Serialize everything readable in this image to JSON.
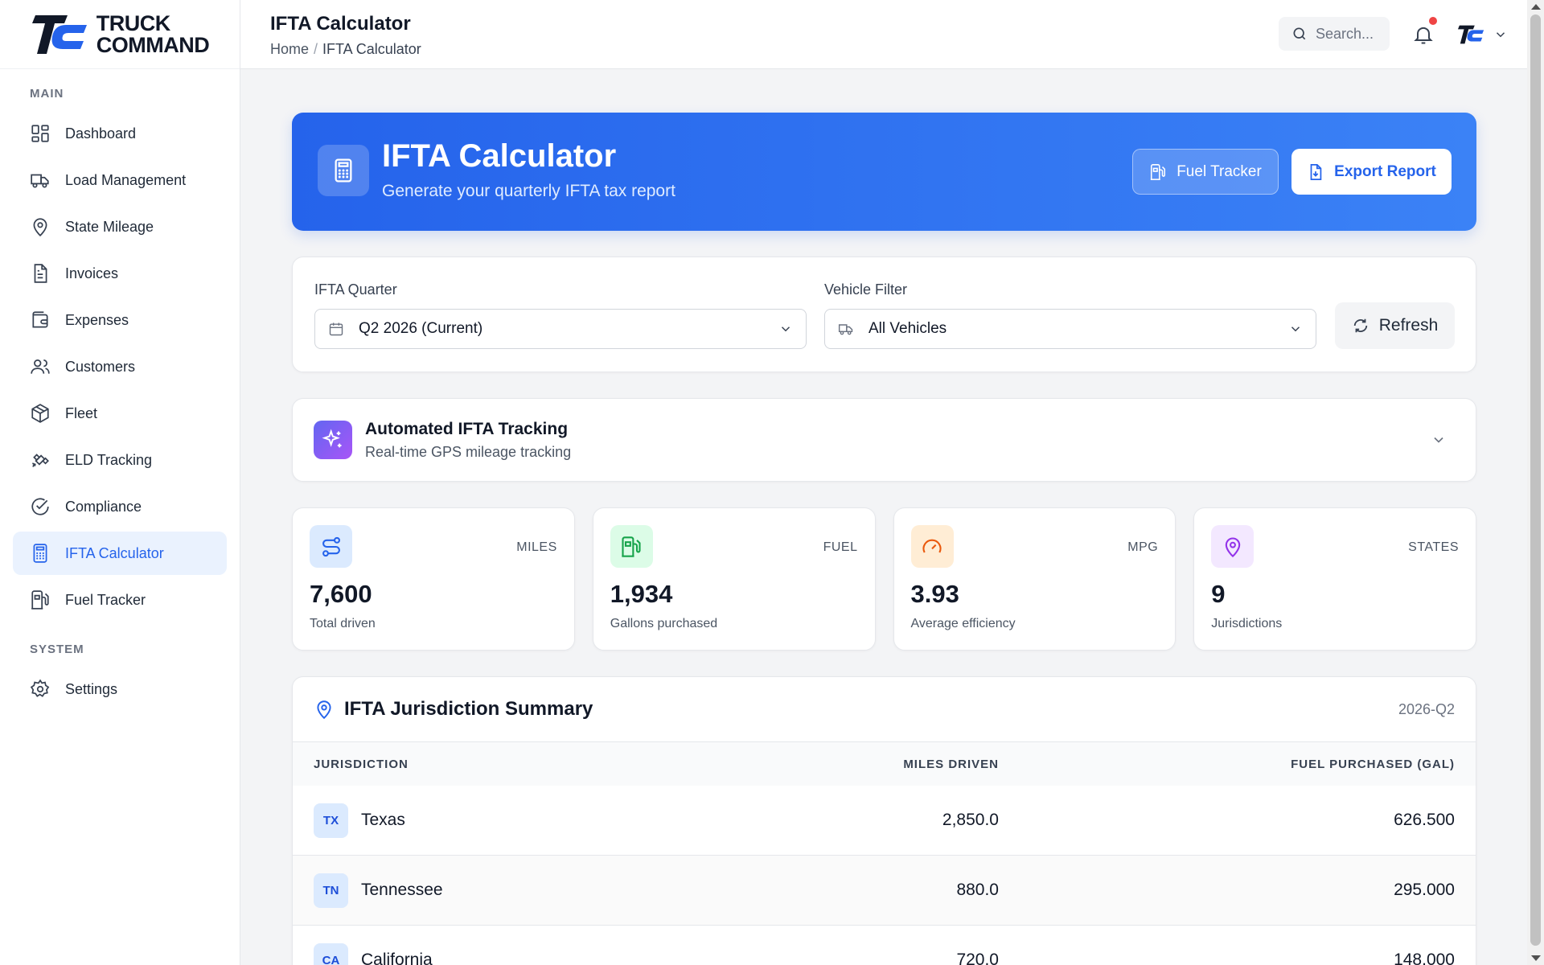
{
  "brand": {
    "line1": "TRUCK",
    "line2": "COMMAND",
    "accent": "#2563eb"
  },
  "sidebar": {
    "main_label": "MAIN",
    "items": [
      {
        "label": "Dashboard",
        "icon": "grid-icon"
      },
      {
        "label": "Load Management",
        "icon": "truck-icon"
      },
      {
        "label": "State Mileage",
        "icon": "map-pin-icon"
      },
      {
        "label": "Invoices",
        "icon": "file-icon"
      },
      {
        "label": "Expenses",
        "icon": "wallet-icon"
      },
      {
        "label": "Customers",
        "icon": "users-icon"
      },
      {
        "label": "Fleet",
        "icon": "package-icon"
      },
      {
        "label": "ELD Tracking",
        "icon": "satellite-icon"
      },
      {
        "label": "Compliance",
        "icon": "check-circle-icon"
      },
      {
        "label": "IFTA Calculator",
        "icon": "calculator-icon",
        "active": true
      },
      {
        "label": "Fuel Tracker",
        "icon": "fuel-icon"
      }
    ],
    "system_label": "SYSTEM",
    "system_items": [
      {
        "label": "Settings",
        "icon": "gear-icon"
      }
    ]
  },
  "header": {
    "title": "IFTA Calculator",
    "breadcrumb": {
      "home": "Home",
      "separator": "/",
      "current": "IFTA Calculator"
    },
    "search_placeholder": "Search..."
  },
  "hero": {
    "title": "IFTA Calculator",
    "subtitle": "Generate your quarterly IFTA tax report",
    "fuel_tracker_label": "Fuel Tracker",
    "export_label": "Export Report"
  },
  "filters": {
    "quarter_label": "IFTA Quarter",
    "quarter_value": "Q2 2026 (Current)",
    "vehicle_label": "Vehicle Filter",
    "vehicle_value": "All Vehicles",
    "refresh_label": "Refresh"
  },
  "automation": {
    "title": "Automated IFTA Tracking",
    "subtitle": "Real-time GPS mileage tracking"
  },
  "stats": [
    {
      "label": "MILES",
      "value": "7,600",
      "caption": "Total driven",
      "bg": "#dbeafe",
      "fg": "#2563eb"
    },
    {
      "label": "FUEL",
      "value": "1,934",
      "caption": "Gallons purchased",
      "bg": "#dcfce7",
      "fg": "#16a34a"
    },
    {
      "label": "MPG",
      "value": "3.93",
      "caption": "Average efficiency",
      "bg": "#ffedd5",
      "fg": "#ea580c"
    },
    {
      "label": "STATES",
      "value": "9",
      "caption": "Jurisdictions",
      "bg": "#f3e8ff",
      "fg": "#9333ea"
    }
  ],
  "summary": {
    "title": "IFTA Jurisdiction Summary",
    "period": "2026-Q2",
    "columns": [
      "JURISDICTION",
      "MILES DRIVEN",
      "FUEL PURCHASED (GAL)"
    ],
    "rows": [
      {
        "code": "TX",
        "state": "Texas",
        "miles": "2,850.0",
        "fuel": "626.500"
      },
      {
        "code": "TN",
        "state": "Tennessee",
        "miles": "880.0",
        "fuel": "295.000"
      },
      {
        "code": "CA",
        "state": "California",
        "miles": "720.0",
        "fuel": "148.000"
      }
    ]
  }
}
